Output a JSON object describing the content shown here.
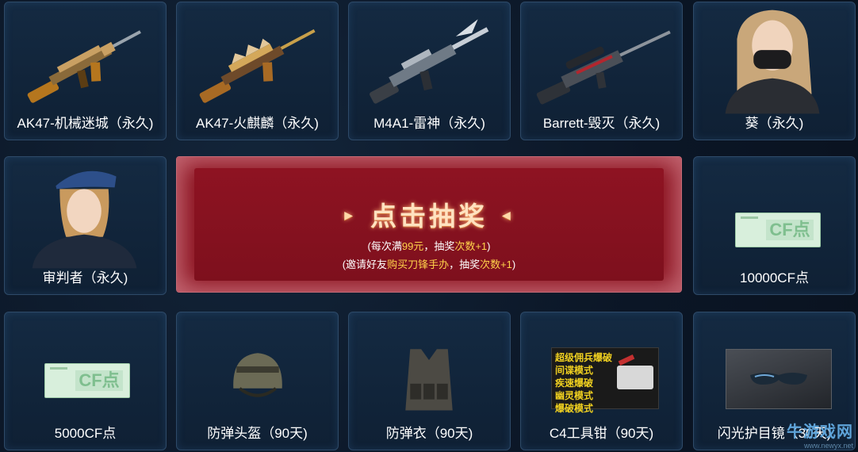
{
  "rewards": [
    {
      "label": "AK47-机械迷城（永久)",
      "icon": "rifle-icon"
    },
    {
      "label": "AK47-火麒麟（永久)",
      "icon": "rifle-icon"
    },
    {
      "label": "M4A1-雷神（永久)",
      "icon": "rifle-icon"
    },
    {
      "label": "Barrett-毁灭（永久)",
      "icon": "sniper-rifle-icon"
    },
    {
      "label": "葵（永久)",
      "icon": "character-icon"
    },
    {
      "label": "审判者（永久)",
      "icon": "character-icon"
    },
    {
      "label": "10000CF点",
      "icon": "cf-points-card-icon",
      "card_text": "CF点"
    },
    {
      "label": "5000CF点",
      "icon": "cf-points-card-icon",
      "card_text": "CF点"
    },
    {
      "label": "防弹头盔（90天)",
      "icon": "helmet-icon"
    },
    {
      "label": "防弹衣（90天)",
      "icon": "vest-icon"
    },
    {
      "label": "C4工具钳（90天)",
      "icon": "c4-pliers-icon",
      "modes": [
        "超级",
        "佣兵",
        "爆破",
        "间谍",
        "模式",
        "疾速",
        "爆破",
        "幽灵",
        "模式",
        "爆破",
        "模式"
      ]
    },
    {
      "label": "闪光护目镜（30天)",
      "icon": "goggles-icon"
    }
  ],
  "draw": {
    "title": "点击抽奖",
    "line1": {
      "p1": "(每次满",
      "p2": "99元",
      "p3": "，抽奖",
      "p4": "次数+1",
      "p5": ")"
    },
    "line2": {
      "p1": "(邀请好友",
      "p2": "购买刀锋手办",
      "p3": "，抽奖",
      "p4": "次数+1",
      "p5": ")"
    }
  },
  "watermark": {
    "name": "牛游戏网",
    "url": "www.newyx.net"
  },
  "colors": {
    "accent_gold": "#ffd24a",
    "draw_red": "#8b1320",
    "card_border": "#2e4a68",
    "cf_green": "#7fbf8f"
  }
}
